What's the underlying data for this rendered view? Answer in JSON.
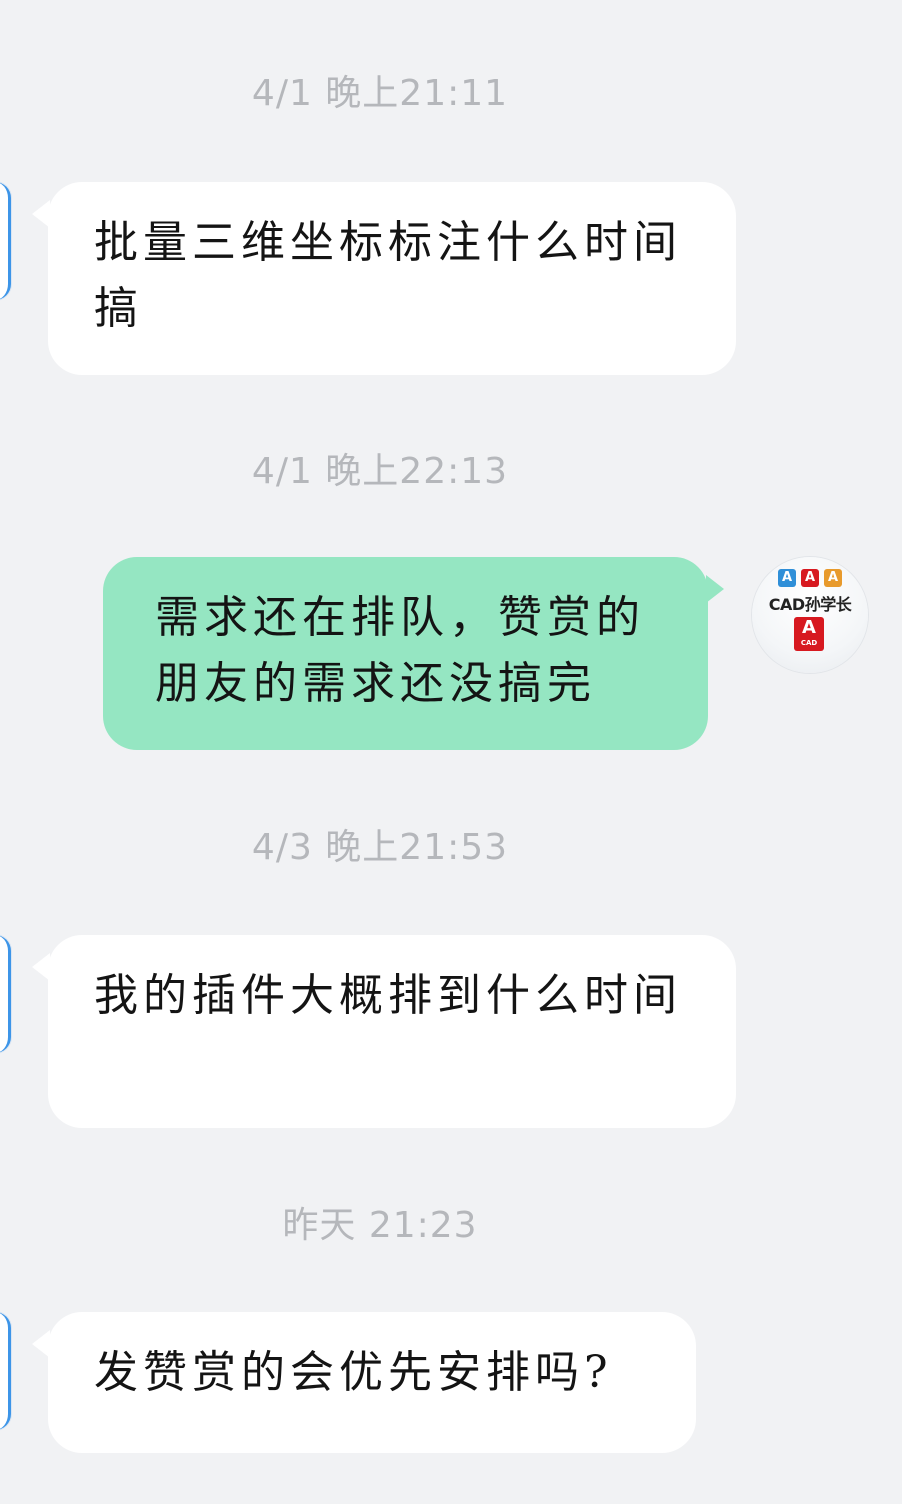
{
  "messages": [
    {
      "time": "4/1 晚上21:11",
      "text": "批量三维坐标标注什么时间搞",
      "direction": "incoming"
    },
    {
      "time": "4/1 晚上22:13",
      "text": "需求还在排队，赞赏的朋友的需求还没搞完",
      "direction": "outgoing"
    },
    {
      "time": "4/3 晚上21:53",
      "text": "我的插件大概排到什么时间",
      "direction": "incoming"
    },
    {
      "time": "昨天 21:23",
      "text": "发赞赏的会优先安排吗?",
      "direction": "incoming"
    }
  ],
  "self_avatar": {
    "label": "CAD孙学长",
    "logo_letter": "A",
    "logo_caption": "CAD",
    "brand_color": "#d71920"
  },
  "colors": {
    "background": "#f1f2f4",
    "incoming_bubble": "#ffffff",
    "outgoing_bubble": "#95e6c2",
    "timestamp": "#b5b7bb"
  }
}
